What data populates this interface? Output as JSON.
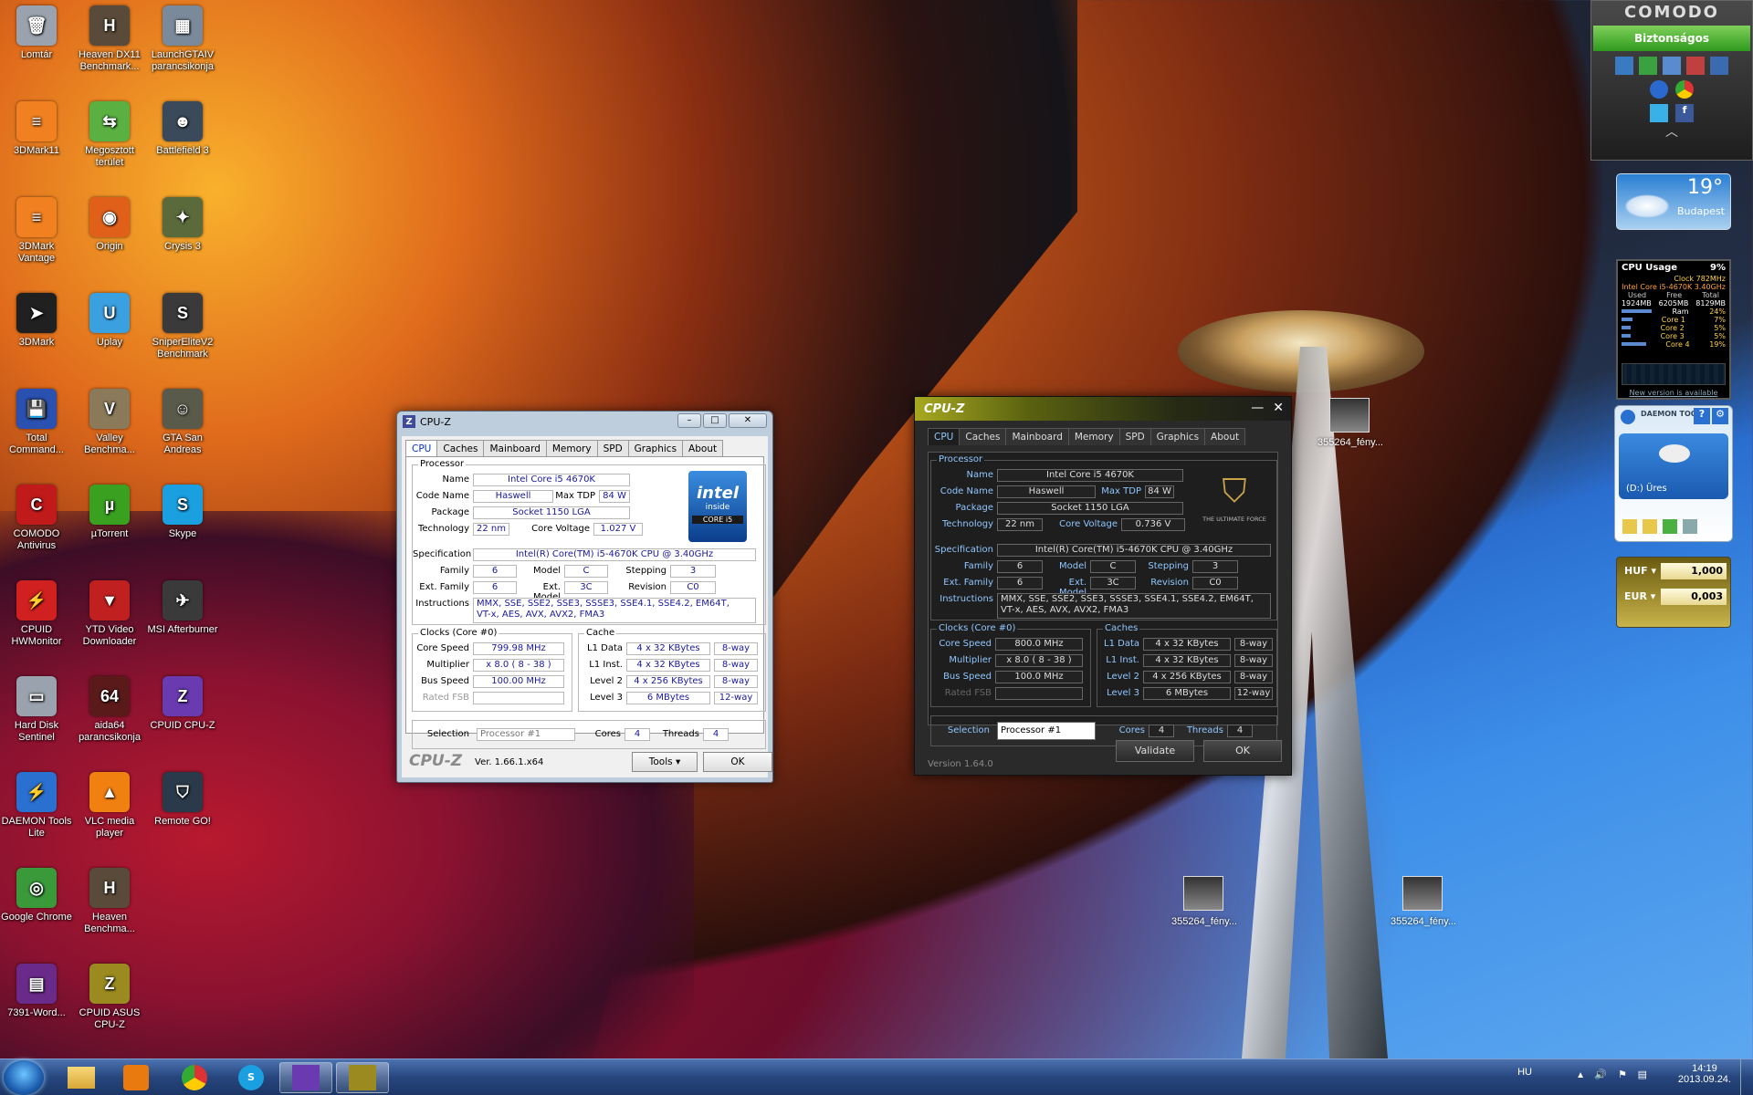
{
  "desktop_icons": [
    {
      "label": "Lomtár",
      "color": "#9aa3ad",
      "glyph": "🗑"
    },
    {
      "label": "Heaven DX11 Benchmark...",
      "color": "#5a4a3a",
      "glyph": "H"
    },
    {
      "label": "LaunchGTAIV parancsikonja",
      "color": "#7a8a9a",
      "glyph": "▦"
    },
    {
      "label": "3DMark11",
      "color": "#f08020",
      "glyph": "≡"
    },
    {
      "label": "Megosztott terület",
      "color": "#5ab040",
      "glyph": "⇆"
    },
    {
      "label": "Battlefield 3",
      "color": "#3a4a5a",
      "glyph": "☻"
    },
    {
      "label": "3DMark Vantage",
      "color": "#f08020",
      "glyph": "≡"
    },
    {
      "label": "Origin",
      "color": "#e0601a",
      "glyph": "◉"
    },
    {
      "label": "Crysis 3",
      "color": "#5a6a3a",
      "glyph": "✦"
    },
    {
      "label": "3DMark",
      "color": "#202020",
      "glyph": "➤"
    },
    {
      "label": "Uplay",
      "color": "#3aa0e0",
      "glyph": "U"
    },
    {
      "label": "SniperEliteV2 Benchmark",
      "color": "#3a3a3a",
      "glyph": "S"
    },
    {
      "label": "Total Command...",
      "color": "#2a50b0",
      "glyph": "💾"
    },
    {
      "label": "Valley Benchma...",
      "color": "#8a7a5a",
      "glyph": "V"
    },
    {
      "label": "GTA San Andreas",
      "color": "#5a5a4a",
      "glyph": "☺"
    },
    {
      "label": "COMODO Antivirus",
      "color": "#c01a1a",
      "glyph": "C"
    },
    {
      "label": "µTorrent",
      "color": "#3aa020",
      "glyph": "µ"
    },
    {
      "label": "Skype",
      "color": "#1aa0e0",
      "glyph": "S"
    },
    {
      "label": "CPUID HWMonitor",
      "color": "#d02020",
      "glyph": "⚡"
    },
    {
      "label": "YTD Video Downloader",
      "color": "#c02020",
      "glyph": "▼"
    },
    {
      "label": "MSI Afterburner",
      "color": "#3a3a3a",
      "glyph": "✈"
    },
    {
      "label": "Hard Disk Sentinel",
      "color": "#9aa3ad",
      "glyph": "▭"
    },
    {
      "label": "aida64 parancsikonja",
      "color": "#5a1a1a",
      "glyph": "64"
    },
    {
      "label": "CPUID CPU-Z",
      "color": "#6a3ab0",
      "glyph": "Z"
    },
    {
      "label": "DAEMON Tools Lite",
      "color": "#2a70d0",
      "glyph": "⚡"
    },
    {
      "label": "VLC media player",
      "color": "#f08010",
      "glyph": "▲"
    },
    {
      "label": "Remote GO!",
      "color": "#2a3a4a",
      "glyph": "⛉"
    },
    {
      "label": "Google Chrome",
      "color": "#3a9a3a",
      "glyph": "◎"
    },
    {
      "label": "Heaven Benchma...",
      "color": "#5a4a3a",
      "glyph": "H"
    },
    {
      "label": "7391-Word...",
      "color": "#6a2a8a",
      "glyph": "▤"
    },
    {
      "label": "CPUID ASUS CPU-Z",
      "color": "#9a8a20",
      "glyph": "Z"
    }
  ],
  "cpuz_classic": {
    "title": "CPU-Z",
    "tabs": [
      "CPU",
      "Caches",
      "Mainboard",
      "Memory",
      "SPD",
      "Graphics",
      "About"
    ],
    "processor_group": "Processor",
    "labels": {
      "name": "Name",
      "code_name": "Code Name",
      "max_tdp": "Max TDP",
      "package": "Package",
      "technology": "Technology",
      "core_voltage": "Core Voltage",
      "specification": "Specification",
      "family": "Family",
      "model": "Model",
      "stepping": "Stepping",
      "ext_family": "Ext. Family",
      "ext_model": "Ext. Model",
      "revision": "Revision",
      "instructions": "Instructions"
    },
    "values": {
      "name": "Intel Core i5 4670K",
      "code_name": "Haswell",
      "max_tdp": "84 W",
      "package": "Socket 1150 LGA",
      "technology": "22 nm",
      "core_voltage": "1.027 V",
      "specification": "Intel(R) Core(TM) i5-4670K CPU @ 3.40GHz",
      "family": "6",
      "model": "C",
      "stepping": "3",
      "ext_family": "6",
      "ext_model": "3C",
      "revision": "C0",
      "instructions_1": "MMX, SSE, SSE2, SSE3, SSSE3, SSE4.1, SSE4.2, EM64T,",
      "instructions_2": "VT-x, AES, AVX, AVX2, FMA3"
    },
    "intel_badge": {
      "brand": "intel",
      "inside": "inside",
      "line": "CORE i5"
    },
    "clocks_group": "Clocks (Core #0)",
    "clocks": {
      "core_speed_label": "Core Speed",
      "core_speed": "799.98 MHz",
      "multiplier_label": "Multiplier",
      "multiplier": "x 8.0 ( 8 - 38 )",
      "bus_speed_label": "Bus Speed",
      "bus_speed": "100.00 MHz",
      "rated_fsb_label": "Rated FSB",
      "rated_fsb": ""
    },
    "cache_group": "Cache",
    "cache": [
      {
        "label": "L1 Data",
        "size": "4 x 32 KBytes",
        "way": "8-way"
      },
      {
        "label": "L1 Inst.",
        "size": "4 x 32 KBytes",
        "way": "8-way"
      },
      {
        "label": "Level 2",
        "size": "4 x 256 KBytes",
        "way": "8-way"
      },
      {
        "label": "Level 3",
        "size": "6 MBytes",
        "way": "12-way"
      }
    ],
    "selection_label": "Selection",
    "selection": "Processor #1",
    "cores_label": "Cores",
    "cores": "4",
    "threads_label": "Threads",
    "threads": "4",
    "brand": "CPU-Z",
    "version": "Ver. 1.66.1.x64",
    "tools": "Tools",
    "ok": "OK"
  },
  "cpuz_asus": {
    "title": "CPU-Z",
    "tabs": [
      "CPU",
      "Caches",
      "Mainboard",
      "Memory",
      "SPD",
      "Graphics",
      "About"
    ],
    "processor_group": "Processor",
    "values": {
      "name": "Intel Core i5 4670K",
      "code_name": "Haswell",
      "max_tdp": "84 W",
      "package": "Socket 1150 LGA",
      "technology": "22 nm",
      "core_voltage": "0.736 V",
      "specification": "Intel(R) Core(TM) i5-4670K CPU @ 3.40GHz",
      "family": "6",
      "model": "C",
      "stepping": "3",
      "ext_family": "6",
      "ext_model": "3C",
      "revision": "C0",
      "instructions_1": "MMX, SSE, SSE2, SSE3, SSSE3, SSE4.1, SSE4.2, EM64T,",
      "instructions_2": "VT-x, AES, AVX, AVX2, FMA3"
    },
    "logo_text": "THE ULTIMATE FORCE",
    "clocks_group": "Clocks (Core #0)",
    "clocks": {
      "core_speed": "800.0 MHz",
      "multiplier": "x 8.0 ( 8 - 38 )",
      "bus_speed": "100.0 MHz",
      "rated_fsb": ""
    },
    "caches_group": "Caches",
    "cache": [
      {
        "label": "L1 Data",
        "size": "4 x 32 KBytes",
        "way": "8-way"
      },
      {
        "label": "L1 Inst.",
        "size": "4 x 32 KBytes",
        "way": "8-way"
      },
      {
        "label": "Level 2",
        "size": "4 x 256 KBytes",
        "way": "8-way"
      },
      {
        "label": "Level 3",
        "size": "6 MBytes",
        "way": "12-way"
      }
    ],
    "selection": "Processor #1",
    "cores": "4",
    "threads": "4",
    "version": "Version 1.64.0",
    "validate": "Validate",
    "ok": "OK"
  },
  "comodo": {
    "title": "COMODO",
    "status": "Biztonságos"
  },
  "weather": {
    "temp": "19°",
    "city": "Budapest"
  },
  "cpu_usage": {
    "title": "CPU Usage",
    "percent": "9%",
    "clock": "Clock 782MHz",
    "cpu": "Intel Core i5-4670K 3.40GHz",
    "mem_headers": [
      "Used",
      "Free",
      "Total"
    ],
    "mem_values": [
      "1924MB",
      "6205MB",
      "8129MB"
    ],
    "rows": [
      {
        "label": "Ram",
        "value": "24%"
      },
      {
        "label": "Core 1",
        "value": "7%"
      },
      {
        "label": "Core 2",
        "value": "5%"
      },
      {
        "label": "Core 3",
        "value": "5%"
      },
      {
        "label": "Core 4",
        "value": "19%"
      }
    ],
    "footer": "New version is available"
  },
  "daemon": {
    "title": "DAEMON TOOLS",
    "drive": "(D:) Üres"
  },
  "currency": [
    {
      "code": "HUF",
      "value": "1,000"
    },
    {
      "code": "EUR",
      "value": "0,003"
    }
  ],
  "desktop_files": [
    {
      "label": "355264_fény..."
    },
    {
      "label": "355264_fény..."
    },
    {
      "label": "355264_fény..."
    }
  ],
  "taskbar": {
    "apps": [
      "explorer",
      "media-player",
      "chrome",
      "skype",
      "cpuz",
      "cpuz-asus"
    ],
    "lang": "HU",
    "time": "14:19",
    "date": "2013.09.24."
  }
}
